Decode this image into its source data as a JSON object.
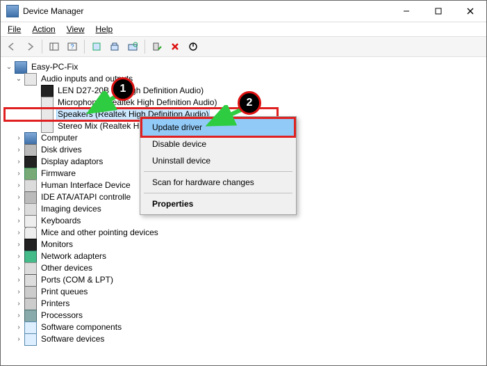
{
  "window": {
    "title": "Device Manager"
  },
  "menus": {
    "file": "File",
    "action": "Action",
    "view": "View",
    "help": "Help"
  },
  "tree": {
    "root": "Easy-PC-Fix",
    "audio": {
      "label": "Audio inputs and outputs",
      "children": {
        "len": "LEN D27-20B (         A High Definition Audio)",
        "mic": "Microphone (Realtek High Definition Audio)",
        "spk": "Speakers (Realtek High Definition Audio)",
        "mix": "Stereo Mix (Realtek H"
      }
    },
    "cats": [
      "Computer",
      "Disk drives",
      "Display adaptors",
      "Firmware",
      "Human Interface Device",
      "IDE ATA/ATAPI controlle",
      "Imaging devices",
      "Keyboards",
      "Mice and other pointing devices",
      "Monitors",
      "Network adapters",
      "Other devices",
      "Ports (COM & LPT)",
      "Print queues",
      "Printers",
      "Processors",
      "Software components",
      "Software devices"
    ]
  },
  "ctx": {
    "update": "Update driver",
    "disable": "Disable device",
    "uninstall": "Uninstall device",
    "scan": "Scan for hardware changes",
    "props": "Properties"
  },
  "badges": {
    "one": "1",
    "two": "2"
  }
}
